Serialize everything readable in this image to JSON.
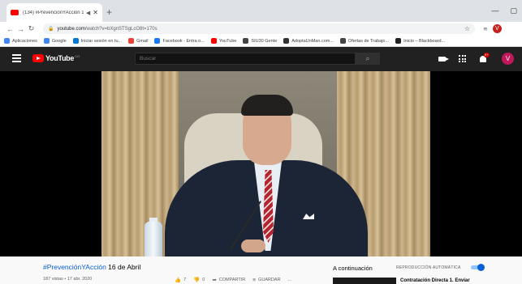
{
  "browser": {
    "tab_title": "(134) #PrevenciónYAcción 1",
    "url_host": "youtube.com",
    "url_path": "/watch?v=bXgnSTSgLcO8t=170s",
    "bookmarks": [
      {
        "label": "Aplicaciones",
        "color": "#4285f4"
      },
      {
        "label": "Google",
        "color": "#4285f4"
      },
      {
        "label": "Iniciar sesión en tu...",
        "color": "#0078d4"
      },
      {
        "label": "Gmail",
        "color": "#ea4335"
      },
      {
        "label": "Facebook - Entra o...",
        "color": "#1877f2"
      },
      {
        "label": "YouTube",
        "color": "#ff0000"
      },
      {
        "label": "SIU30 Gente",
        "color": "#444444"
      },
      {
        "label": "AdoptaUnMan.com...",
        "color": "#333333"
      },
      {
        "label": "Ofertas de Trabajo...",
        "color": "#444444"
      },
      {
        "label": "Inicio – Blackboard...",
        "color": "#222222"
      }
    ],
    "profile_initial": "V"
  },
  "youtube": {
    "logo_text": "YouTube",
    "logo_country": "CO",
    "search_placeholder": "Buscar",
    "notifications_badge": "9+",
    "avatar_initial": "V"
  },
  "video": {
    "title_hashtag": "#PrevenciónYAcción",
    "title_rest": " 16 de Abril",
    "meta": "187 vistas • 17 abr. 2020",
    "likes": "7",
    "dislikes": "0",
    "share_label": "COMPARTIR",
    "save_label": "GUARDAR",
    "more_label": "..."
  },
  "sidebar": {
    "up_next_label": "A continuación",
    "autoplay_label": "REPRODUCCIÓN AUTOMÁTICA",
    "autoplay_on": true,
    "next_video_title": "Contratación Directa 1. Enviar"
  },
  "colors": {
    "youtube_red": "#ff0000",
    "accent_blue": "#065fd4",
    "masthead": "#212121"
  }
}
